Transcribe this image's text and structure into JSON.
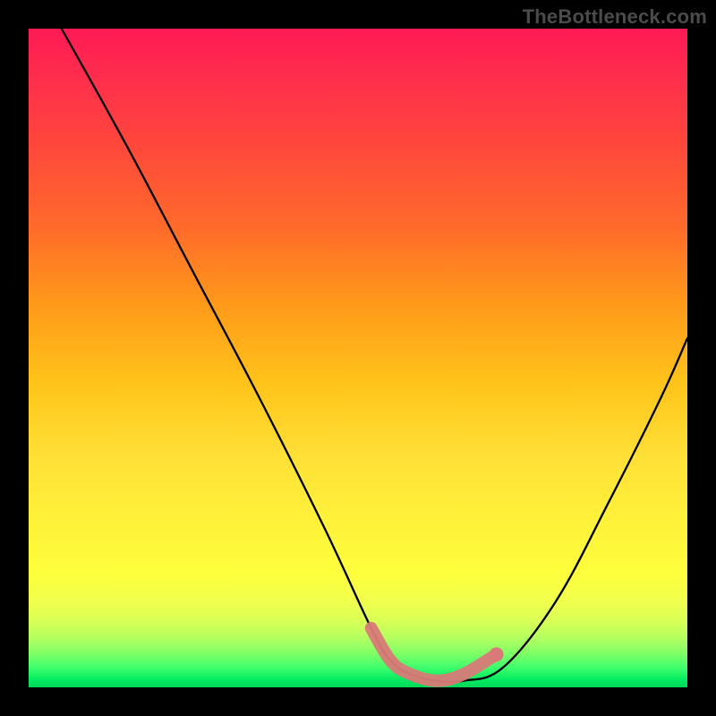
{
  "watermark": "TheBottleneck.com",
  "chart_data": {
    "type": "line",
    "title": "",
    "xlabel": "",
    "ylabel": "",
    "xlim": [
      0,
      100
    ],
    "ylim": [
      0,
      100
    ],
    "grid": false,
    "legend": false,
    "series": [
      {
        "name": "black-curve",
        "color": "#000000",
        "x": [
          5,
          15,
          25,
          35,
          45,
          52,
          55,
          58,
          62,
          66,
          72,
          80,
          88,
          96,
          100
        ],
        "y": [
          100,
          82,
          63,
          44,
          24,
          9,
          4,
          2,
          1,
          1,
          3,
          13,
          28,
          44,
          53
        ]
      },
      {
        "name": "highlight-band",
        "color": "#d97a78",
        "x": [
          52,
          55,
          58,
          62,
          66,
          71
        ],
        "y": [
          9,
          4,
          2,
          1,
          2,
          5
        ]
      }
    ],
    "annotations": []
  },
  "colors": {
    "curve_black": "#000000",
    "highlight": "#d97a78",
    "frame": "#000000"
  }
}
